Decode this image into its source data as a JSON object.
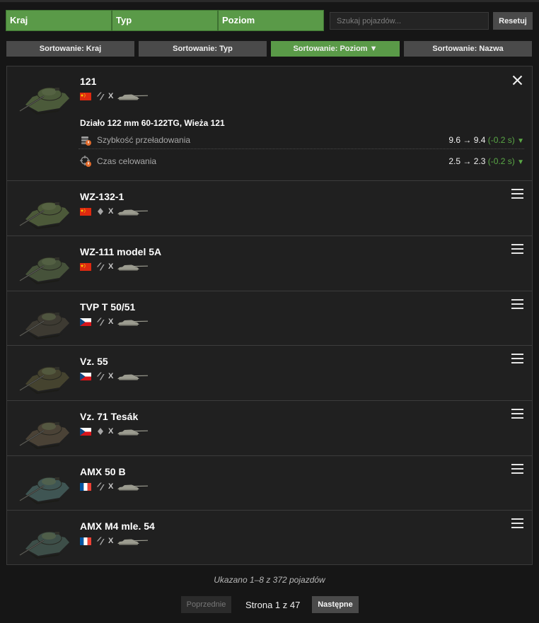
{
  "filters": [
    {
      "label": "Kraj"
    },
    {
      "label": "Typ"
    },
    {
      "label": "Poziom"
    }
  ],
  "search": {
    "placeholder": "Szukaj pojazdów..."
  },
  "reset_label": "Resetuj",
  "sort_options": [
    {
      "label": "Sortowanie: Kraj",
      "active": false
    },
    {
      "label": "Sortowanie: Typ",
      "active": false
    },
    {
      "label": "Sortowanie: Poziom ▼",
      "active": true
    },
    {
      "label": "Sortowanie: Nazwa",
      "active": false
    }
  ],
  "vehicles": [
    {
      "name": "121",
      "nation": "china",
      "tier": "X",
      "type_icon": "double-chevron",
      "hull_color": "#4b5a3a",
      "expanded": true
    },
    {
      "name": "WZ-132-1",
      "nation": "china",
      "tier": "X",
      "type_icon": "diamond",
      "hull_color": "#4c5939"
    },
    {
      "name": "WZ-111 model 5A",
      "nation": "china",
      "tier": "X",
      "type_icon": "double-chevron",
      "hull_color": "#46523a"
    },
    {
      "name": "TVP T 50/51",
      "nation": "czech",
      "tier": "X",
      "type_icon": "double-chevron",
      "hull_color": "#3d3a32"
    },
    {
      "name": "Vz. 55",
      "nation": "czech",
      "tier": "X",
      "type_icon": "double-chevron",
      "hull_color": "#45432f"
    },
    {
      "name": "Vz. 71 Tesák",
      "nation": "czech",
      "tier": "X",
      "type_icon": "diamond",
      "hull_color": "#4a4236"
    },
    {
      "name": "AMX 50 B",
      "nation": "france",
      "tier": "X",
      "type_icon": "double-chevron",
      "hull_color": "#3f5553"
    },
    {
      "name": "AMX M4 mle. 54",
      "nation": "france",
      "tier": "X",
      "type_icon": "double-chevron",
      "hull_color": "#3d4e48"
    }
  ],
  "expanded_details": {
    "module_title": "Działo 122 mm 60-122TG, Wieża 121",
    "stats": [
      {
        "label": "Szybkość przeładowania",
        "value": "9.6 → 9.4",
        "delta": "(-0.2 s)",
        "icon": "reload-icon"
      },
      {
        "label": "Czas celowania",
        "value": "2.5 → 2.3",
        "delta": "(-0.2 s)",
        "icon": "aim-icon"
      }
    ]
  },
  "showing_text": "Ukazano 1–8 z 372 pojazdów",
  "pagination": {
    "prev_label": "Poprzednie",
    "page_text": "Strona 1 z 47",
    "next_label": "Następne"
  },
  "colors": {
    "accent_green": "#5a9a48",
    "delta_green": "#5aa846",
    "china_red": "#de2910",
    "gold": "#ffde00"
  }
}
